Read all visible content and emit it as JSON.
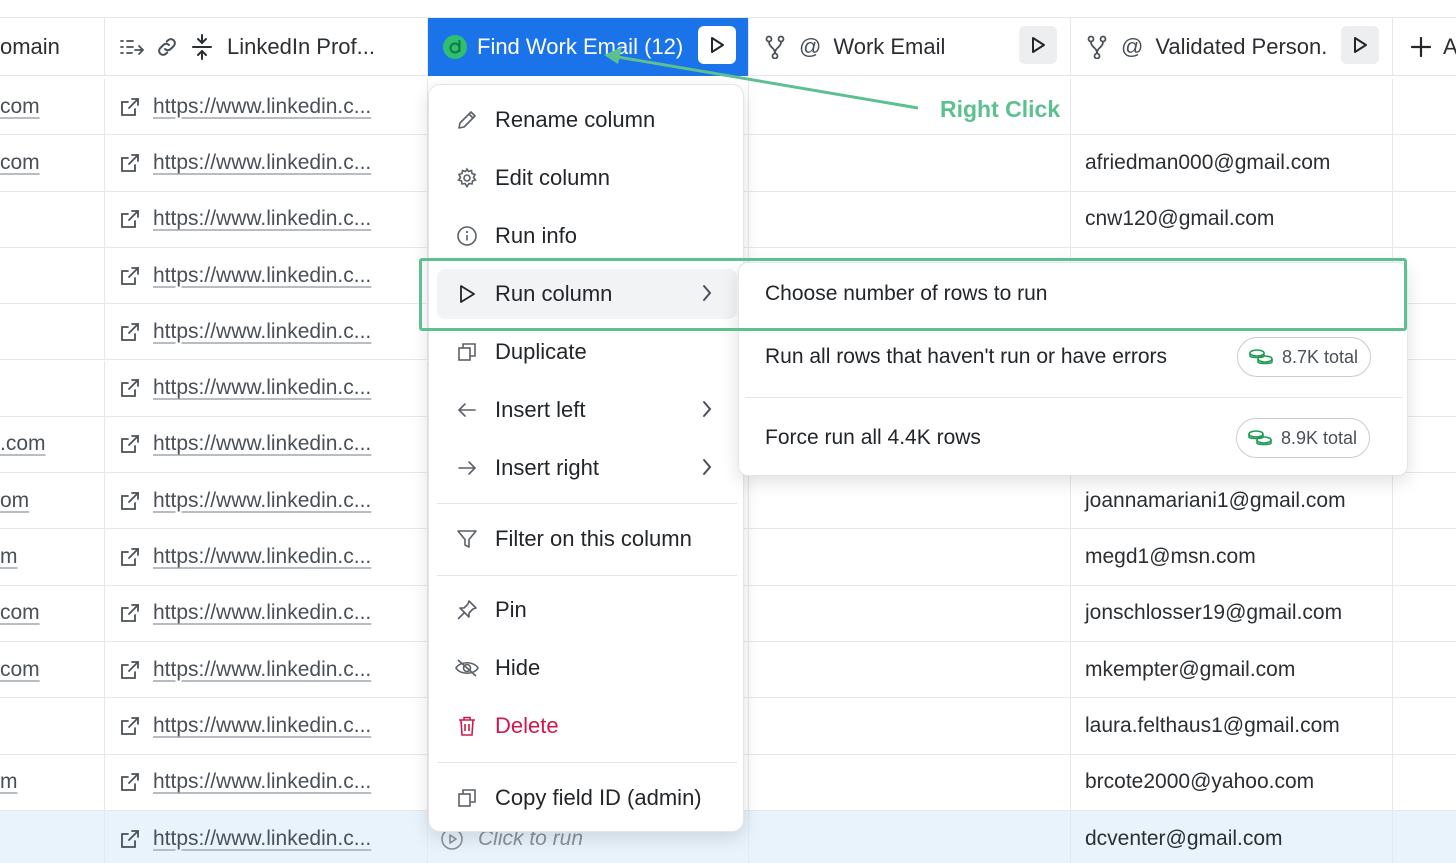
{
  "header": {
    "domain_col": "omain",
    "linkedin_col": "LinkedIn Prof...",
    "find_col": "Find Work Email (12)",
    "work_email_col": "Work Email",
    "validated_col": "Validated Person.",
    "add_col": "A"
  },
  "rows": [
    {
      "domain": "com",
      "link": "https://www.linkedin.c...",
      "email": ""
    },
    {
      "domain": "com",
      "link": "https://www.linkedin.c...",
      "email": "afriedman000@gmail.com"
    },
    {
      "domain": "",
      "link": "https://www.linkedin.c...",
      "email": "cnw120@gmail.com"
    },
    {
      "domain": "",
      "link": "https://www.linkedin.c...",
      "email": ""
    },
    {
      "domain": "",
      "link": "https://www.linkedin.c...",
      "email": ""
    },
    {
      "domain": "",
      "link": "https://www.linkedin.c...",
      "email": ""
    },
    {
      "domain": ".com",
      "link": "https://www.linkedin.c...",
      "email": ""
    },
    {
      "domain": "om",
      "link": "https://www.linkedin.c...",
      "email": "joannamariani1@gmail.com"
    },
    {
      "domain": "m",
      "link": "https://www.linkedin.c...",
      "email": "megd1@msn.com"
    },
    {
      "domain": "com",
      "link": "https://www.linkedin.c...",
      "email": "jonschlosser19@gmail.com"
    },
    {
      "domain": "com",
      "link": "https://www.linkedin.c...",
      "email": "mkempter@gmail.com"
    },
    {
      "domain": "",
      "link": "https://www.linkedin.c...",
      "email": "laura.felthaus1@gmail.com"
    },
    {
      "domain": "m",
      "link": "https://www.linkedin.c...",
      "email": "brcote2000@yahoo.com"
    },
    {
      "domain": "",
      "link": "https://www.linkedin.c...",
      "email": "dcventer@gmail.com",
      "click_to_run": "Click to run"
    }
  ],
  "menu": {
    "rename": "Rename column",
    "edit": "Edit column",
    "run_info": "Run info",
    "run_column": "Run column",
    "duplicate": "Duplicate",
    "insert_left": "Insert left",
    "insert_right": "Insert right",
    "filter": "Filter on this column",
    "pin": "Pin",
    "hide": "Hide",
    "delete": "Delete",
    "copy_id": "Copy field ID (admin)"
  },
  "submenu": {
    "choose_rows": "Choose number of rows to run",
    "run_unrun": "Run all rows that haven't run or have errors",
    "run_unrun_credits": "8.7K total",
    "force_run": "Force run all 4.4K rows",
    "force_run_credits": "8.9K total"
  },
  "annotation": {
    "label": "Right Click",
    "color": "#5cc08f"
  },
  "colors": {
    "accent": "#1a73e8",
    "danger": "#d2184b",
    "annotation": "#5cc08f",
    "row_highlight": "#e8f3fb"
  }
}
